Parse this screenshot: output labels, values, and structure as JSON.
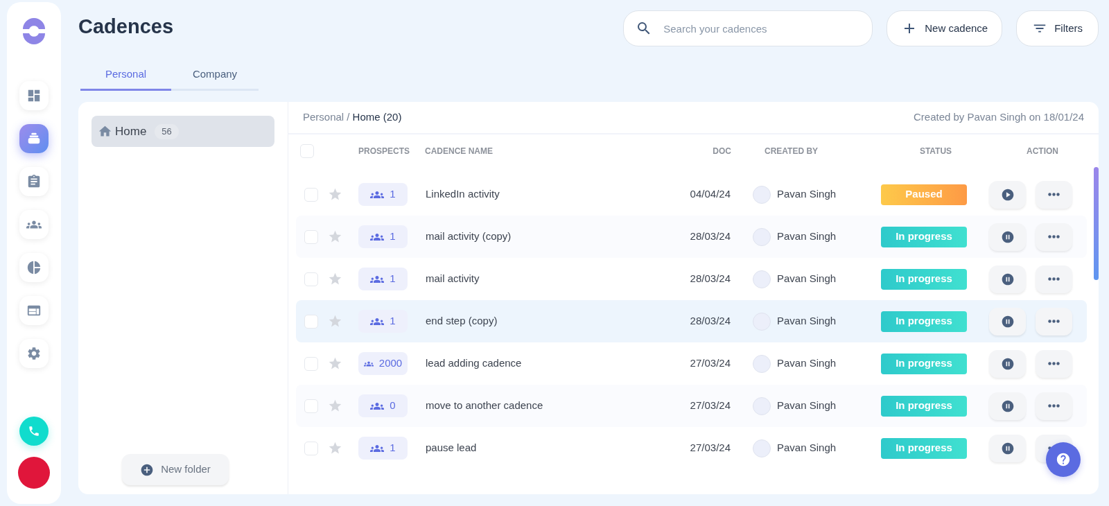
{
  "sidebar": {
    "nav_items": [
      {
        "kind": "dashboard",
        "selected": false
      },
      {
        "kind": "cadences",
        "selected": true
      },
      {
        "kind": "tasks",
        "selected": false
      },
      {
        "kind": "people",
        "selected": false
      },
      {
        "kind": "reports",
        "selected": false
      },
      {
        "kind": "templates",
        "selected": false
      },
      {
        "kind": "settings",
        "selected": false
      }
    ]
  },
  "header": {
    "title": "Cadences",
    "search": {
      "placeholder": "Search your cadences"
    },
    "buttons": [
      "New cadence",
      "Filters"
    ]
  },
  "tabs": [
    {
      "label": "Personal",
      "selected": true
    },
    {
      "label": "Company",
      "selected": false
    }
  ],
  "folders": {
    "items": [
      {
        "label": "Home",
        "count": "56",
        "selected": true
      }
    ],
    "new_folder": "New folder"
  },
  "table": {
    "breadcrumb": {
      "parent": "Personal /",
      "current": "Home (20)"
    },
    "created_info": "Created by Pavan Singh on 18/01/24",
    "select_all_checked": false,
    "columns": [
      "PROSPECTS",
      "CADENCE NAME",
      "DOC",
      "CREATED BY",
      "STATUS",
      "ACTION"
    ],
    "rows": [
      {
        "checked": false,
        "starred": false,
        "prospects": "1",
        "name": "LinkedIn activity",
        "doc": "04/04/24",
        "created_by": "Pavan Singh",
        "status": "Paused",
        "paused": true,
        "selected": false
      },
      {
        "checked": false,
        "starred": false,
        "prospects": "1",
        "name": "mail activity (copy)",
        "doc": "28/03/24",
        "created_by": "Pavan Singh",
        "status": "In progress",
        "paused": false,
        "selected": false
      },
      {
        "checked": false,
        "starred": false,
        "prospects": "1",
        "name": "mail activity",
        "doc": "28/03/24",
        "created_by": "Pavan Singh",
        "status": "In progress",
        "paused": false,
        "selected": false
      },
      {
        "checked": false,
        "starred": false,
        "prospects": "1",
        "name": "end step (copy)",
        "doc": "28/03/24",
        "created_by": "Pavan Singh",
        "status": "In progress",
        "paused": false,
        "selected": true
      },
      {
        "checked": false,
        "starred": false,
        "prospects": "2000",
        "name": "lead adding cadence",
        "doc": "27/03/24",
        "created_by": "Pavan Singh",
        "status": "In progress",
        "paused": false,
        "selected": false
      },
      {
        "checked": false,
        "starred": false,
        "prospects": "0",
        "name": "move to another cadence",
        "doc": "27/03/24",
        "created_by": "Pavan Singh",
        "status": "In progress",
        "paused": false,
        "selected": false
      },
      {
        "checked": false,
        "starred": false,
        "prospects": "1",
        "name": "pause lead",
        "doc": "27/03/24",
        "created_by": "Pavan Singh",
        "status": "In progress",
        "paused": false,
        "selected": false
      }
    ]
  }
}
